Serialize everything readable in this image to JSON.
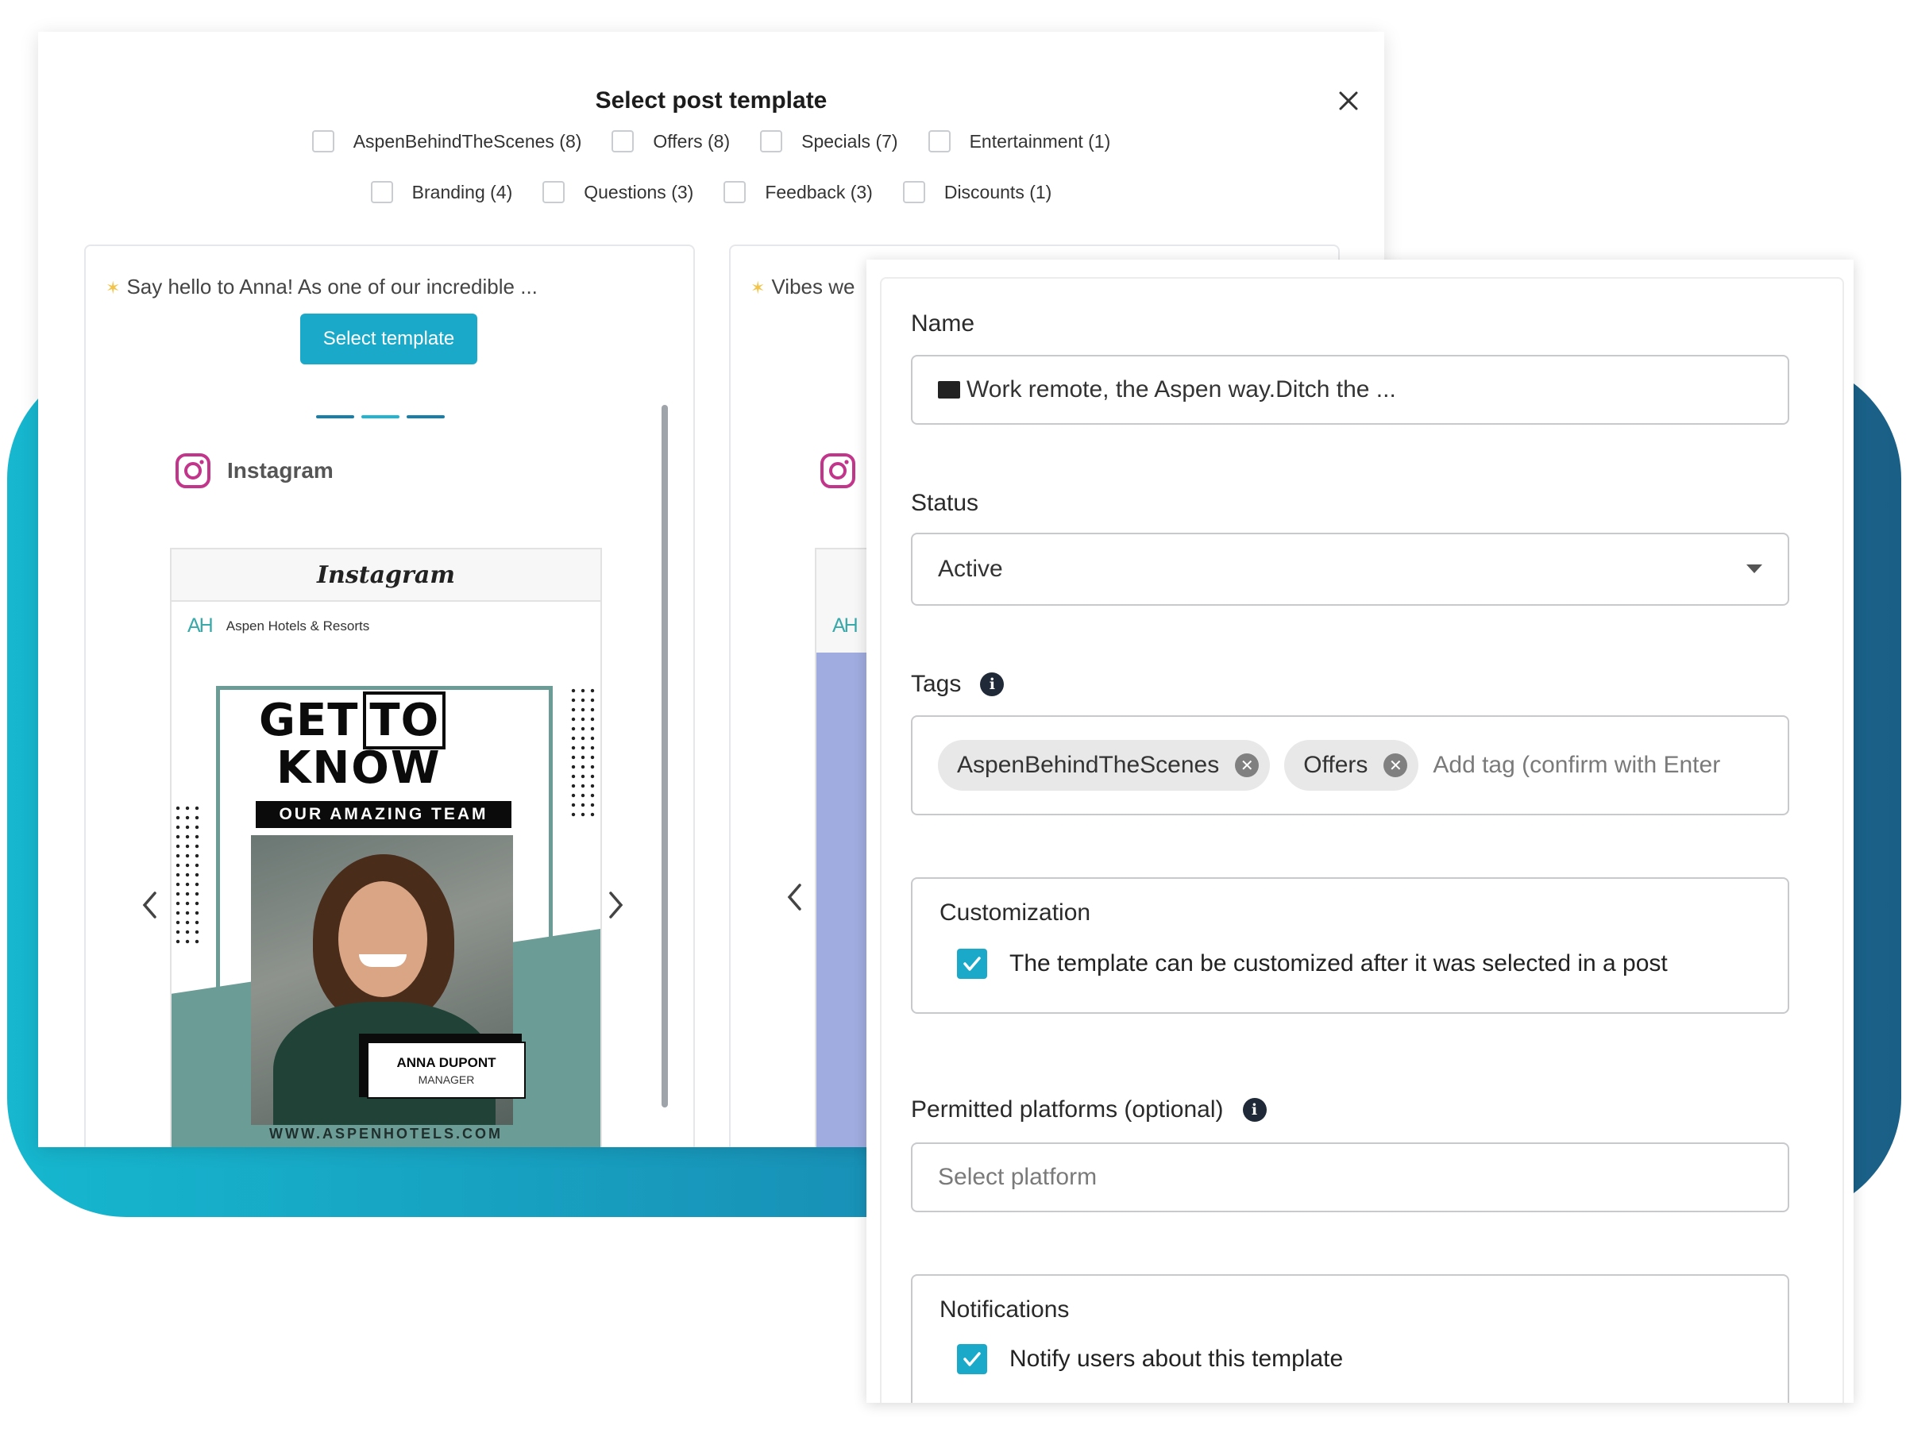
{
  "modal": {
    "title": "Select post template",
    "filters_row1": [
      {
        "label": "AspenBehindTheScenes (8)"
      },
      {
        "label": "Offers (8)"
      },
      {
        "label": "Specials (7)"
      },
      {
        "label": "Entertainment (1)"
      }
    ],
    "filters_row2": [
      {
        "label": "Branding (4)"
      },
      {
        "label": "Questions (3)"
      },
      {
        "label": "Feedback (3)"
      },
      {
        "label": "Discounts (1)"
      }
    ],
    "card1": {
      "caption": "Say hello to Anna! As one of our incredible ...",
      "select_button": "Select template",
      "platform_label": "Instagram",
      "post_header": "Instagram",
      "account_logo": "AH",
      "account_name": "Aspen Hotels & Resorts",
      "image_heading_get": "GET",
      "image_heading_to": "TO",
      "image_heading_know": "KNOW",
      "image_subheading": "OUR AMAZING TEAM",
      "badge_name": "ANNA DUPONT",
      "badge_role": "MANAGER",
      "image_url": "WWW.ASPENHOTELS.COM"
    },
    "card2": {
      "caption": "Vibes we",
      "account_logo": "AH"
    }
  },
  "form": {
    "name_label": "Name",
    "name_value": "Work remote, the Aspen way.Ditch the ...",
    "status_label": "Status",
    "status_value": "Active",
    "tags_label": "Tags",
    "tags": [
      {
        "label": "AspenBehindTheScenes"
      },
      {
        "label": "Offers"
      }
    ],
    "tags_placeholder": "Add tag (confirm with Enter",
    "customization_legend": "Customization",
    "customization_text": "The template can be customized after it was selected in a post",
    "customization_checked": true,
    "platforms_label": "Permitted platforms (optional)",
    "platforms_placeholder": "Select platform",
    "notifications_legend": "Notifications",
    "notifications_text": "Notify users about this template",
    "notifications_checked": true
  },
  "colors": {
    "accent": "#1aa9c8",
    "backdrop_start": "#16b7cf",
    "backdrop_end": "#1a5f86",
    "instagram": "#c1358a",
    "image_teal": "#6c9c96"
  },
  "icons": [
    "close-icon",
    "sparkle-icon",
    "instagram-icon",
    "chevron-left-icon",
    "chevron-right-icon",
    "laptop-icon",
    "caret-down-icon",
    "info-icon",
    "remove-tag-icon",
    "checkmark-icon"
  ]
}
